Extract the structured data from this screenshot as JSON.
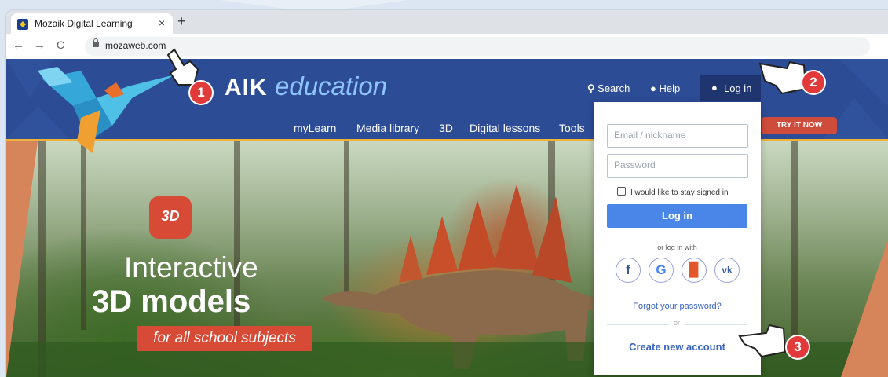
{
  "browser": {
    "tab_title": "Mozaik Digital Learning",
    "tab_close": "×",
    "new_tab": "+",
    "back": "←",
    "forward": "→",
    "reload": "C",
    "url": "mozaweb.com"
  },
  "site": {
    "brand": "AIK",
    "brand_sub": "education",
    "top_nav": {
      "search": "Search",
      "help": "Help",
      "login": "Log in"
    },
    "menu": [
      "myLearn",
      "Media library",
      "3D",
      "Digital lessons",
      "Tools"
    ],
    "try_it_now": "TRY IT NOW"
  },
  "login_panel": {
    "email_placeholder": "Email / nickname",
    "password_placeholder": "Password",
    "stay_signed_in": "I would like to stay signed in",
    "login_button": "Log in",
    "or_log_in_with": "or log in with",
    "social": [
      "facebook-icon",
      "google-icon",
      "office-icon",
      "vk-icon"
    ],
    "forgot_password": "Forgot your password?",
    "or": "or",
    "create_account": "Create new account"
  },
  "hero": {
    "badge": "3D",
    "line1": "Interactive",
    "line2": "3D models",
    "line3": "for all school subjects"
  },
  "annotations": {
    "step1": "1",
    "step2": "2",
    "step3": "3"
  },
  "colors": {
    "header_blue": "#2d4c96",
    "accent_red": "#d64a36",
    "login_blue": "#4a86e8",
    "link_blue": "#3b66c4",
    "marker_red": "#e23a3a"
  }
}
